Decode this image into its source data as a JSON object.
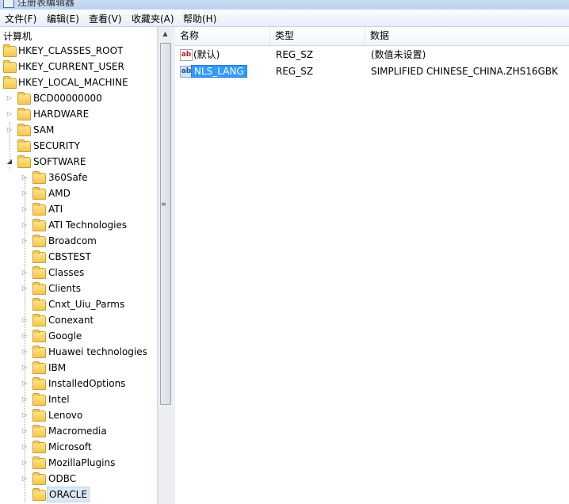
{
  "window": {
    "title": "注册表编辑器"
  },
  "menu": [
    "文件(F)",
    "编辑(E)",
    "查看(V)",
    "收藏夹(A)",
    "帮助(H)"
  ],
  "tree": {
    "root": "计算机",
    "hives": [
      "HKEY_CLASSES_ROOT",
      "HKEY_CURRENT_USER",
      "HKEY_LOCAL_MACHINE"
    ],
    "hklm_children": [
      "BCD00000000",
      "HARDWARE",
      "SAM",
      "SECURITY",
      "SOFTWARE"
    ],
    "software_children": [
      "360Safe",
      "AMD",
      "ATI",
      "ATI Technologies",
      "Broadcom",
      "CBSTEST",
      "Classes",
      "Clients",
      "Cnxt_Uiu_Parms",
      "Conexant",
      "Google",
      "Huawei technologies",
      "IBM",
      "InstalledOptions",
      "Intel",
      "Lenovo",
      "Macromedia",
      "Microsoft",
      "MozillaPlugins",
      "ODBC",
      "ORACLE"
    ],
    "selected": "ORACLE"
  },
  "list": {
    "columns": [
      "名称",
      "类型",
      "数据"
    ],
    "rows": [
      {
        "name": "(默认)",
        "type": "REG_SZ",
        "data": "(数值未设置)"
      },
      {
        "name": "NLS_LANG",
        "type": "REG_SZ",
        "data": "SIMPLIFIED CHINESE_CHINA.ZHS16GBK"
      }
    ],
    "selected_row": 1
  },
  "icons": {
    "folder": "folder-icon",
    "string_value": "string-value-icon"
  }
}
